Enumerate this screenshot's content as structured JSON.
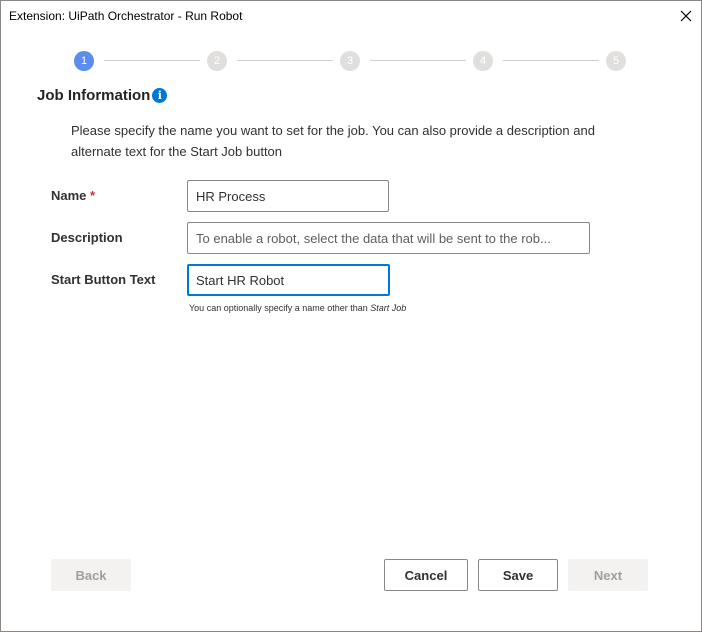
{
  "window": {
    "title": "Extension: UiPath Orchestrator - Run Robot"
  },
  "stepper": {
    "steps": [
      "1",
      "2",
      "3",
      "4",
      "5"
    ],
    "active_step": "1"
  },
  "section": {
    "title": "Job Information",
    "info_icon": "i",
    "description": "Please specify the name you want to set for the job. You can also provide a description and alternate text for the Start Job button"
  },
  "form": {
    "name": {
      "label": "Name",
      "required_marker": "*",
      "value": "HR Process"
    },
    "description": {
      "label": "Description",
      "placeholder": "To enable a robot, select the data that will be sent to the rob..."
    },
    "start_button_text": {
      "label": "Start Button Text",
      "value": "Start HR Robot",
      "hint_prefix": "You can optionally specify a name other than ",
      "hint_emphasis": "Start Job"
    }
  },
  "footer": {
    "back_label": "Back",
    "cancel_label": "Cancel",
    "save_label": "Save",
    "next_label": "Next"
  },
  "colors": {
    "accent": "#0078d4",
    "active_step": "#5b8def",
    "inactive_step": "#e1dfdd",
    "required": "#c4314b"
  }
}
